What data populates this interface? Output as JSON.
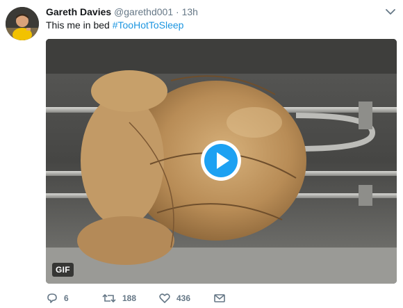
{
  "tweet": {
    "display_name": "Gareth Davies",
    "screen_name": "@garethd001",
    "separator": "·",
    "time": "13h",
    "text": "This me in bed ",
    "hashtag": "#TooHotToSleep"
  },
  "media": {
    "badge": "GIF",
    "play_icon": "play-icon",
    "accent_color": "#1da1f2"
  },
  "actions": {
    "reply_count": "6",
    "retweet_count": "188",
    "like_count": "436",
    "reply_icon": "reply-icon",
    "retweet_icon": "retweet-icon",
    "like_icon": "heart-icon",
    "message_icon": "envelope-icon"
  },
  "colors": {
    "name": "#14171a",
    "meta": "#657786",
    "link": "#1b95e0"
  }
}
